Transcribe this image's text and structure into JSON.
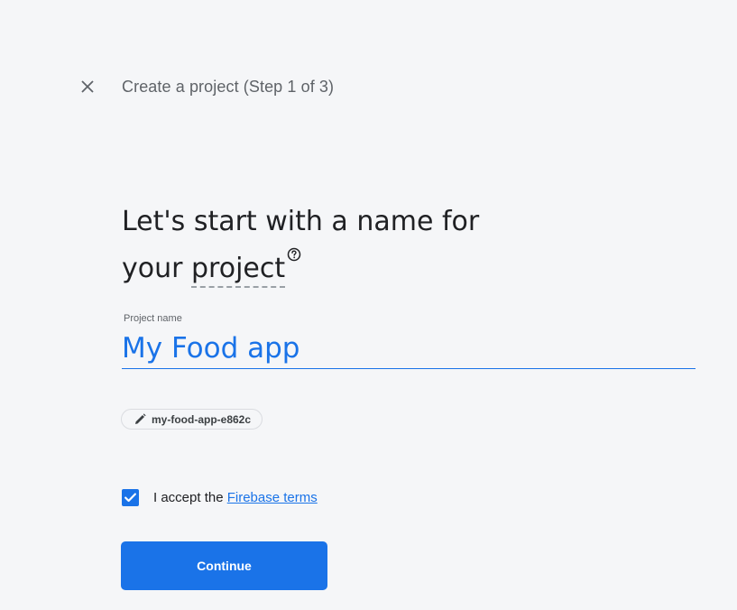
{
  "header": {
    "close_icon": "close-icon",
    "title": "Create a project (Step 1 of 3)"
  },
  "heading": {
    "line1": "Let's start with a name for",
    "line2_prefix": "your ",
    "term": "project",
    "help_icon": "help-circle-icon"
  },
  "project_name": {
    "label": "Project name",
    "value": "My Food app"
  },
  "project_id": {
    "icon": "pencil-icon",
    "value": "my-food-app-e862c"
  },
  "terms": {
    "checked": true,
    "text": "I accept the ",
    "link": "Firebase terms"
  },
  "actions": {
    "continue_label": "Continue"
  },
  "colors": {
    "accent": "#1a73e8",
    "background": "#f5f6f8",
    "text": "#202124",
    "muted": "#5f6368"
  }
}
